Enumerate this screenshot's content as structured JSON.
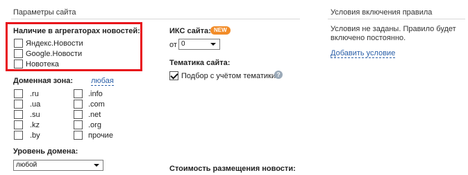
{
  "left_section": {
    "title": "Параметры сайта",
    "aggregators": {
      "heading": "Наличие в агрегаторах новостей:",
      "items": [
        {
          "label": "Яндекс.Новости",
          "checked": false
        },
        {
          "label": "Google.Новости",
          "checked": false
        },
        {
          "label": "Новотека",
          "checked": false
        }
      ]
    },
    "domain_zone": {
      "heading": "Доменная зона:",
      "any_link": "любая",
      "col1": [
        {
          "label": ".ru",
          "checked": false
        },
        {
          "label": ".ua",
          "checked": false
        },
        {
          "label": ".su",
          "checked": false
        },
        {
          "label": ".kz",
          "checked": false
        },
        {
          "label": ".by",
          "checked": false
        }
      ],
      "col2": [
        {
          "label": ".info",
          "checked": false
        },
        {
          "label": ".com",
          "checked": false
        },
        {
          "label": ".net",
          "checked": false
        },
        {
          "label": ".org",
          "checked": false
        },
        {
          "label": "прочие",
          "checked": false
        }
      ]
    },
    "domain_level": {
      "heading": "Уровень домена:",
      "selected": "любой"
    }
  },
  "middle_section": {
    "iks": {
      "heading": "ИКС сайта:",
      "badge": "NEW",
      "from_label": "от",
      "from_value": "0"
    },
    "topic": {
      "heading": "Тематика сайта:",
      "checkbox_label": "Подбор с учётом тематики",
      "checked": true,
      "help_glyph": "?"
    },
    "cost_heading": "Стоимость размещения новости:"
  },
  "right_section": {
    "title": "Условия включения правила",
    "text_line1": "Условия не заданы. Правило будет",
    "text_line2": "включено постоянно.",
    "add_link": "Добавить условие"
  },
  "colors": {
    "highlight_border": "#e8101a",
    "link": "#2a5fa8",
    "badge": "#f28c28"
  },
  "icons": [
    "chevron-down-icon",
    "help-icon",
    "checkmark-icon"
  ]
}
